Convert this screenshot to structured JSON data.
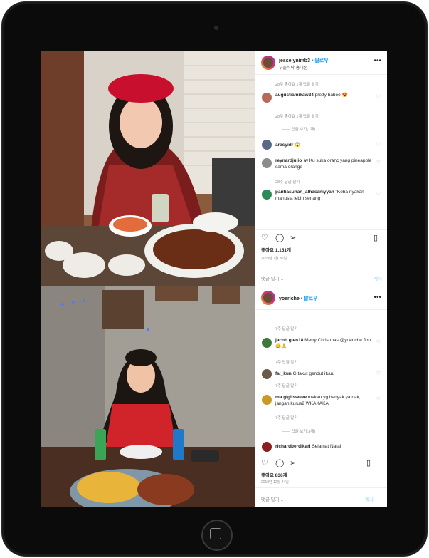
{
  "post1": {
    "username": "jesselynimb3",
    "follow": "• 팔로우",
    "location": "부들식탁 홍대점",
    "comments": [
      {
        "meta": "28주   좋아요 1개    답글 달기"
      },
      {
        "user": "augustiamikaw24",
        "text": "pretty babee 😍",
        "meta": "28주   좋아요 1개    답글 달기"
      },
      {
        "meta": "—— 답글 보기(1개)"
      },
      {
        "user": "arasyidr",
        "text": "😱"
      },
      {
        "user": "reynardjulio_w",
        "text": "Ku suka oranc yang pineapple sama orange",
        "meta": "28주   답글 달기"
      },
      {
        "user": "pantiasuhan_alhasaniyyah",
        "text": "\"Keba nyakan manusia lebih senang"
      }
    ],
    "likes": "좋아요 1,151개",
    "date": "2019년 7월 30일",
    "add_comment": "댓글 달기...",
    "post_btn": "게시"
  },
  "post2": {
    "username": "yoeriche",
    "follow": "• 팔로우",
    "comments": [
      {
        "meta": "7주   답글 달기"
      },
      {
        "user": "jacob.glen18",
        "text": "Merry Christmas @yoenche Jbu 😊🙏",
        "meta": "7주   답글 달기"
      },
      {
        "user": "fai_kun",
        "text": "G takut gendut ituuu",
        "meta": "7주   답글 달기"
      },
      {
        "user": "ma.giglisweee",
        "text": "makan yg banyak ya nak, jangan kurus2 WKAKAKA",
        "meta": "7주   답글 달기"
      },
      {
        "meta": "—— 답글 보기(3개)"
      },
      {
        "user": "richardberdikari",
        "text": "Selamat Natal"
      }
    ],
    "likes": "좋아요 836개",
    "date": "2019년 12월 24일",
    "add_comment": "댓글 달기...",
    "post_btn": "게시"
  },
  "colors": {
    "accent": "#0095f6",
    "tablet": "#0b0b0b"
  }
}
